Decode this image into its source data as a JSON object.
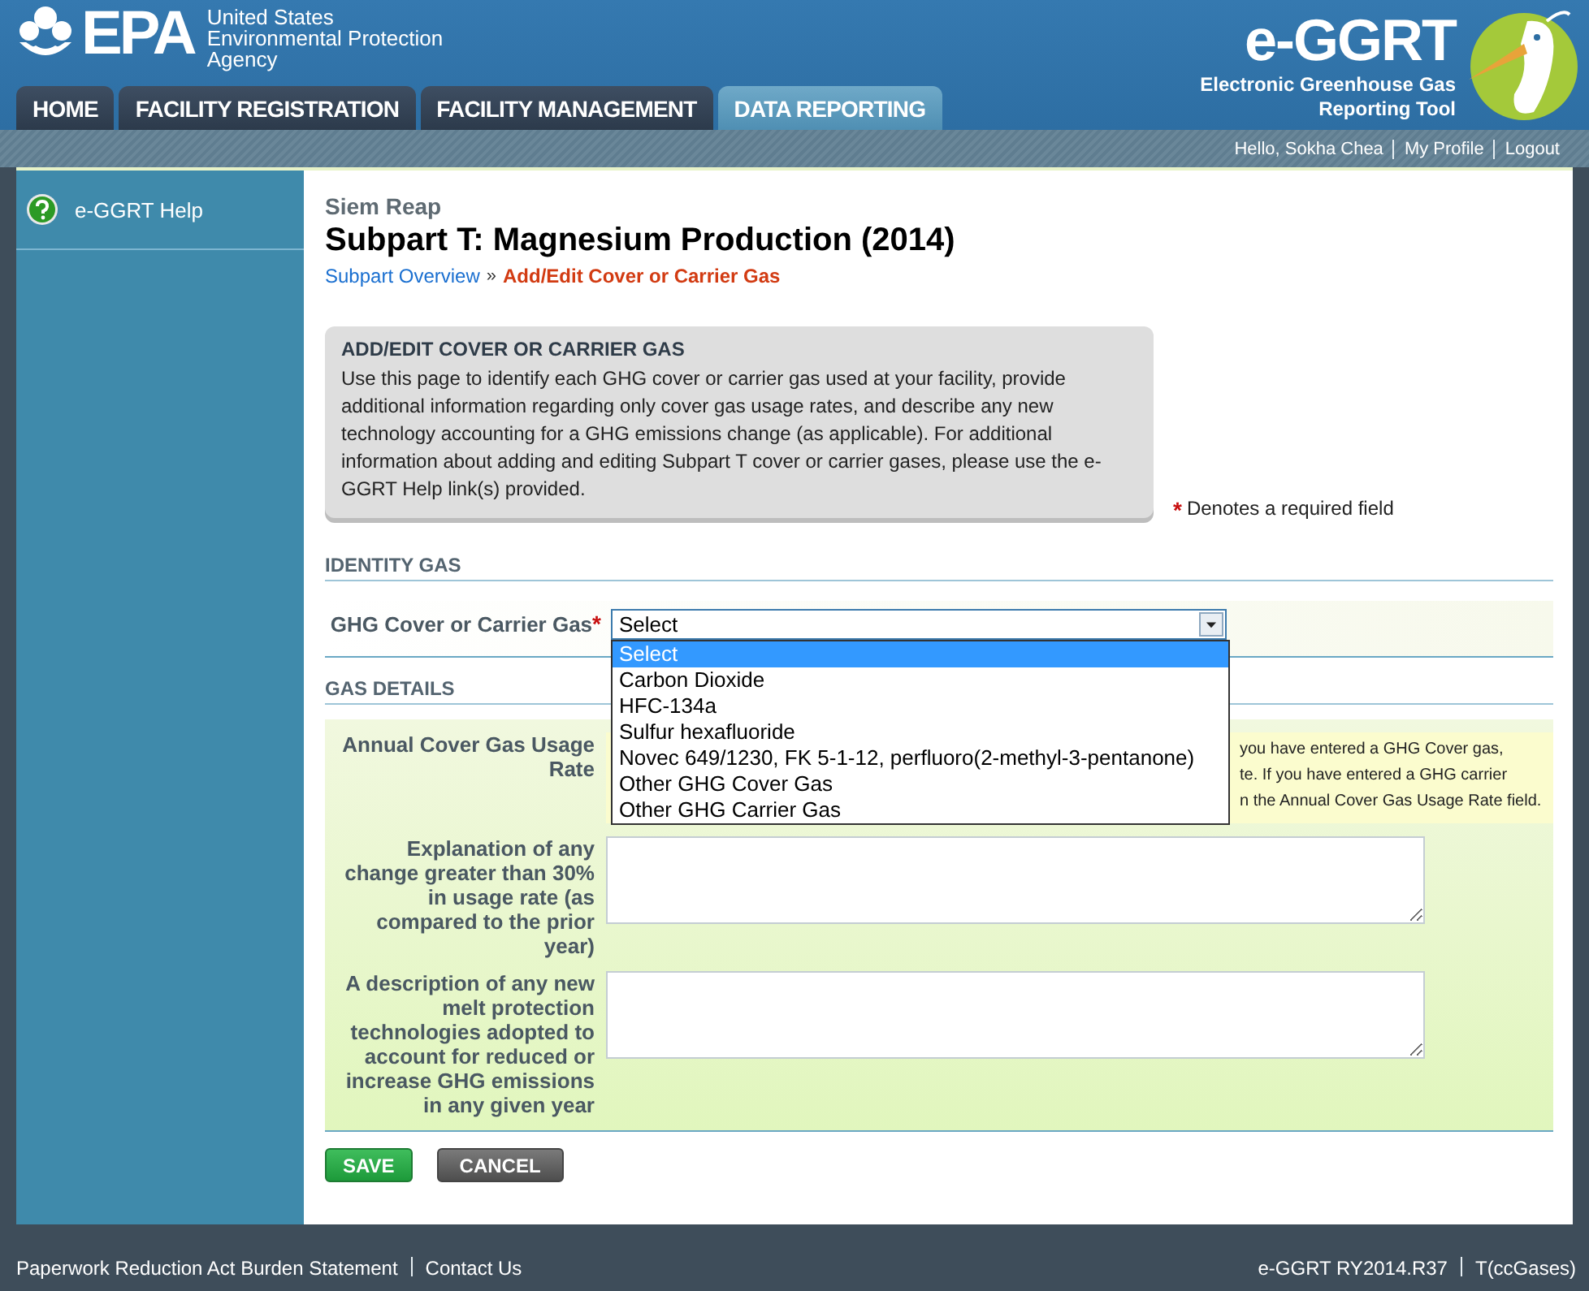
{
  "header": {
    "agency_logo": "EPA",
    "agency_name": [
      "United States",
      "Environmental Protection",
      "Agency"
    ],
    "app_logo": "e-GGRT",
    "app_name": [
      "Electronic Greenhouse Gas",
      "Reporting Tool"
    ]
  },
  "nav_tabs": [
    {
      "label": "HOME",
      "selected": false
    },
    {
      "label": "FACILITY REGISTRATION",
      "selected": false
    },
    {
      "label": "FACILITY MANAGEMENT",
      "selected": false
    },
    {
      "label": "DATA REPORTING",
      "selected": true
    }
  ],
  "user_links": [
    "Hello, Sokha Chea",
    "My Profile",
    "Logout"
  ],
  "sidebar": {
    "items": [
      {
        "label": "e-GGRT Help"
      }
    ]
  },
  "facility": "Siem Reap",
  "title": "Subpart T: Magnesium Production (2014)",
  "breadcrumb": {
    "link": "Subpart Overview",
    "separator": "»",
    "current": "Add/Edit Cover or Carrier Gas"
  },
  "info_box": {
    "heading": "ADD/EDIT COVER OR CARRIER GAS",
    "text": "Use this page to identify each GHG cover or carrier gas used at your facility, provide additional information regarding only cover gas usage rates, and describe any new technology accounting for a GHG emissions change (as applicable). For additional information about adding and editing Subpart T cover or carrier gases, please use the e-GGRT Help link(s) provided."
  },
  "required_note": {
    "mark": "*",
    "text": "Denotes a required field"
  },
  "identity_section": {
    "heading": "IDENTITY GAS",
    "field": {
      "label": "GHG Cover or Carrier Gas",
      "required_mark": "*",
      "value": "Select",
      "expanded": true,
      "options": [
        {
          "label": "Select",
          "selected": true
        },
        {
          "label": "Carbon Dioxide",
          "selected": false
        },
        {
          "label": "HFC-134a",
          "selected": false
        },
        {
          "label": "Sulfur hexafluoride",
          "selected": false
        },
        {
          "label": "Novec 649/1230, FK 5-1-12, perfluoro(2-methyl-3-pentanone)",
          "selected": false
        },
        {
          "label": "Other GHG Cover Gas",
          "selected": false
        },
        {
          "label": "Other GHG Carrier Gas",
          "selected": false
        }
      ]
    }
  },
  "details_section": {
    "heading": "GAS DETAILS",
    "fields": [
      {
        "kind": "note",
        "label": "Annual Cover Gas Usage Rate",
        "note_lines": [
          "you have entered a GHG Cover gas,",
          "te. If you have entered a GHG carrier",
          "n the Annual Cover Gas Usage Rate field."
        ]
      },
      {
        "kind": "textarea",
        "label": "Explanation of any change greater than 30% in usage rate (as compared to the prior year)"
      },
      {
        "kind": "textarea",
        "label": "A description of any new melt protection technologies adopted to account for reduced or increase GHG emissions in any given year"
      }
    ]
  },
  "buttons": [
    {
      "label": "SAVE",
      "kind": "primary"
    },
    {
      "label": "CANCEL",
      "kind": "secondary"
    }
  ],
  "footer": {
    "left": [
      "Paperwork Reduction Act Burden Statement",
      "Contact Us"
    ],
    "right": [
      "e-GGRT RY2014.R37",
      "T(ccGases)"
    ]
  }
}
